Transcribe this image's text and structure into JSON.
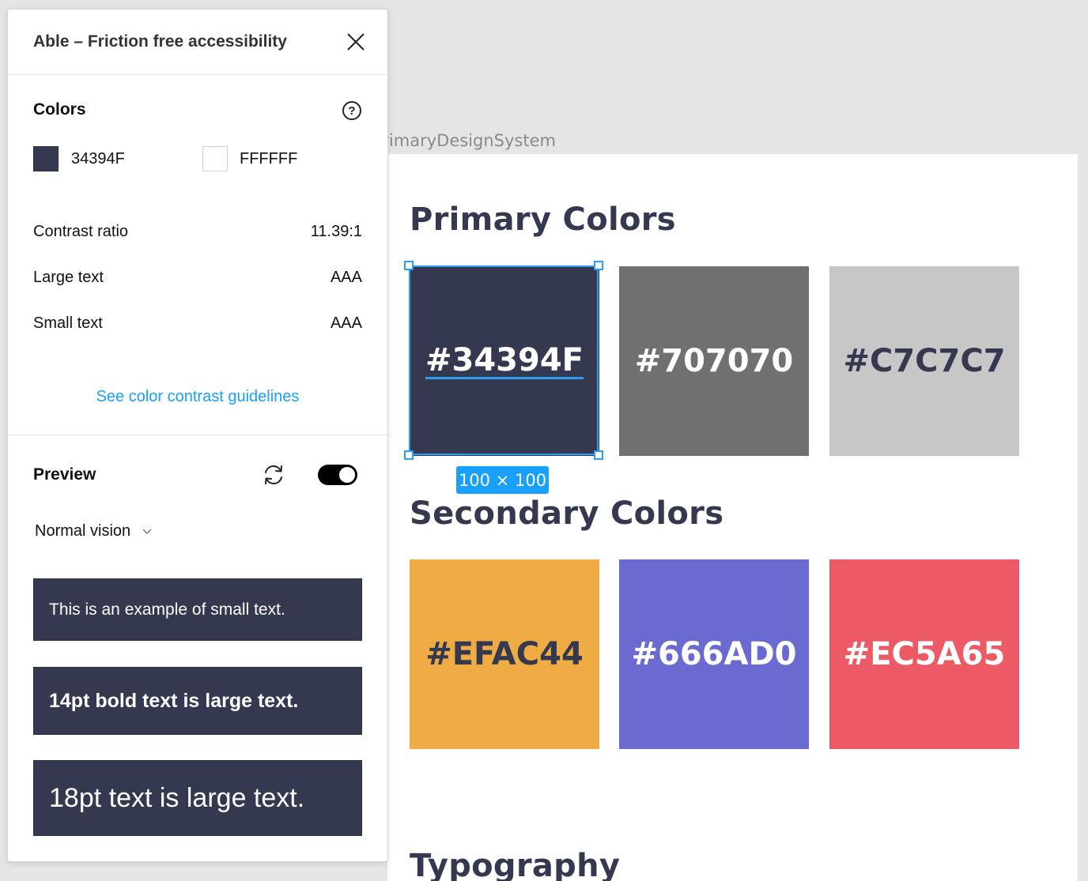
{
  "canvas": {
    "frame_label": "PrimaryDesignSystem",
    "primary_title": "Primary Colors",
    "secondary_title": "Secondary Colors",
    "typography_title": "Typography",
    "selection_size": "100 × 100",
    "primary_swatches": [
      {
        "label": "#34394F",
        "bg": "#34394f",
        "fg": "#ffffff"
      },
      {
        "label": "#707070",
        "bg": "#707070",
        "fg": "#ffffff"
      },
      {
        "label": "#C7C7C7",
        "bg": "#c7c7c7",
        "fg": "#34394f"
      }
    ],
    "secondary_swatches": [
      {
        "label": "#EFAC44",
        "bg": "#efac44",
        "fg": "#34394f"
      },
      {
        "label": "#666AD0",
        "bg": "#6a6ad0",
        "fg": "#ffffff"
      },
      {
        "label": "#EC5A65",
        "bg": "#ec5a65",
        "fg": "#ffffff"
      }
    ]
  },
  "panel": {
    "title": "Able – Friction free accessibility",
    "colors_heading": "Colors",
    "foreground": {
      "value": "34394F",
      "swatch": "#34394f"
    },
    "background": {
      "value": "FFFFFF",
      "swatch": "#ffffff"
    },
    "contrast_label": "Contrast ratio",
    "contrast_value": "11.39:1",
    "large_text_label": "Large text",
    "large_text_value": "AAA",
    "small_text_label": "Small text",
    "small_text_value": "AAA",
    "guidelines_link": "See color contrast guidelines",
    "preview_heading": "Preview",
    "vision_mode": "Normal vision",
    "preview_enabled": true,
    "sample_small": "This is an example of small text.",
    "sample_bold": "14pt bold text is large text.",
    "sample_large": "18pt text is large text."
  }
}
